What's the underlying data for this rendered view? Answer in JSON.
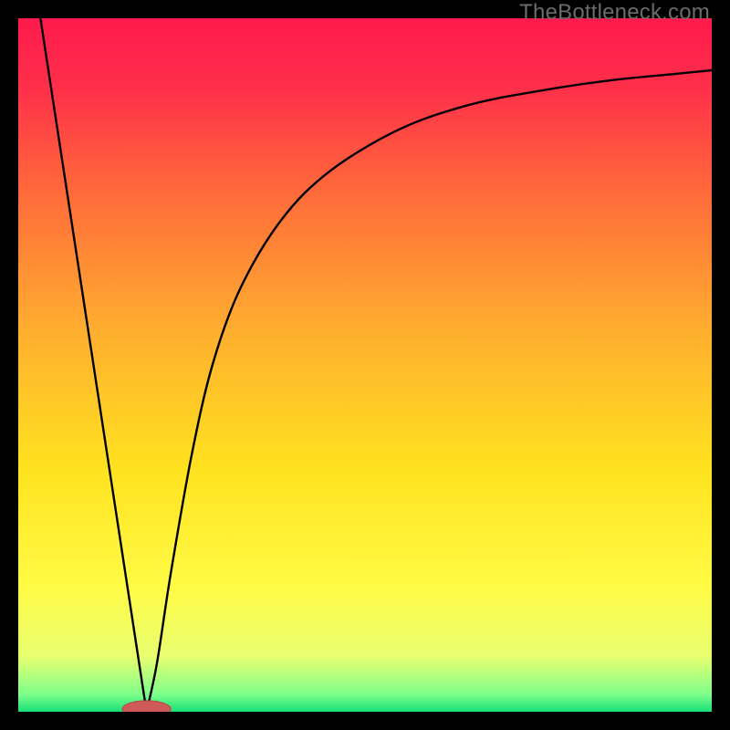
{
  "watermark": "TheBottleneck.com",
  "colors": {
    "frame": "#000000",
    "gradient_stops": [
      {
        "offset": 0.0,
        "color": "#ff1a4d"
      },
      {
        "offset": 0.1,
        "color": "#ff2f4a"
      },
      {
        "offset": 0.25,
        "color": "#ff6a3a"
      },
      {
        "offset": 0.45,
        "color": "#ffae2f"
      },
      {
        "offset": 0.65,
        "color": "#ffe21f"
      },
      {
        "offset": 0.82,
        "color": "#fffb45"
      },
      {
        "offset": 0.92,
        "color": "#e9ff70"
      },
      {
        "offset": 0.975,
        "color": "#7dff8a"
      },
      {
        "offset": 1.0,
        "color": "#18e07a"
      }
    ],
    "curve": "#000000",
    "marker_fill": "#cf5a58",
    "marker_stroke": "#b14846"
  },
  "chart_data": {
    "type": "line",
    "title": "",
    "xlabel": "",
    "ylabel": "",
    "xlim": [
      0,
      100
    ],
    "ylim": [
      0,
      100
    ],
    "marker": {
      "x": 18.5,
      "y": 0,
      "rx": 3.5,
      "ry": 1.2
    },
    "series": [
      {
        "name": "left-leg",
        "segment": "linear",
        "points": [
          {
            "x": 3.2,
            "y": 100
          },
          {
            "x": 18.5,
            "y": 0
          }
        ]
      },
      {
        "name": "right-curve",
        "segment": "curve",
        "points": [
          {
            "x": 18.5,
            "y": 0
          },
          {
            "x": 20,
            "y": 7
          },
          {
            "x": 22,
            "y": 20
          },
          {
            "x": 25,
            "y": 37
          },
          {
            "x": 28,
            "y": 50
          },
          {
            "x": 32,
            "y": 61
          },
          {
            "x": 38,
            "y": 71
          },
          {
            "x": 45,
            "y": 78
          },
          {
            "x": 55,
            "y": 84
          },
          {
            "x": 65,
            "y": 87.5
          },
          {
            "x": 75,
            "y": 89.5
          },
          {
            "x": 85,
            "y": 91
          },
          {
            "x": 95,
            "y": 92
          },
          {
            "x": 100,
            "y": 92.5
          }
        ]
      }
    ]
  }
}
